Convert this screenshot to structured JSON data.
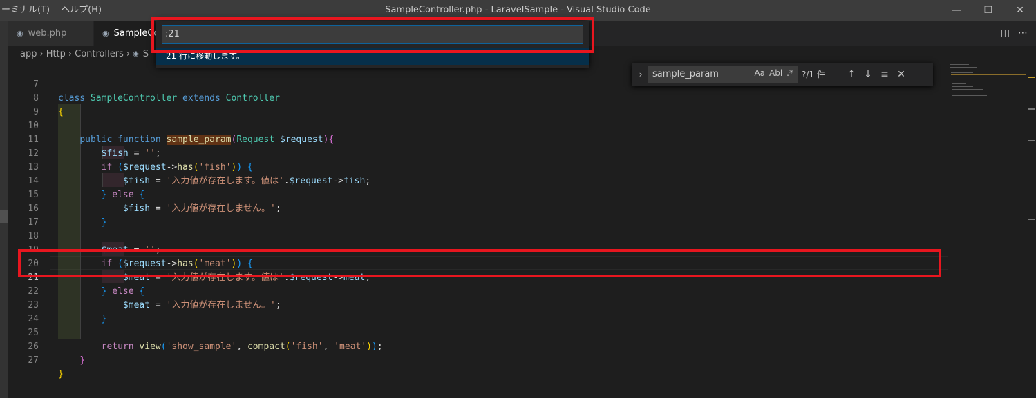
{
  "window": {
    "title": "SampleController.php - LaravelSample - Visual Studio Code",
    "menu": [
      "ーミナル(T)",
      "ヘルプ(H)"
    ]
  },
  "tabs": [
    {
      "label": "web.php",
      "active": false
    },
    {
      "label": "SampleController.php",
      "active": true
    }
  ],
  "breadcrumb": [
    "app",
    "Http",
    "Controllers",
    "S"
  ],
  "quick_open": {
    "value": ":21",
    "hint": "21 行に移動します。"
  },
  "find": {
    "query": "sample_param",
    "match_case": "Aa",
    "whole_word": "Abl",
    "regex": ".*",
    "result": "?/1 件"
  },
  "editor": {
    "current_line": 21,
    "lines": [
      {
        "n": "7",
        "text": "class SampleController extends Controller"
      },
      {
        "n": "8",
        "text": "{"
      },
      {
        "n": "9",
        "text": ""
      },
      {
        "n": "10",
        "text": "    public function sample_param(Request $request){"
      },
      {
        "n": "11",
        "text": "        $fish = '';"
      },
      {
        "n": "12",
        "text": "        if ($request->has('fish')) {"
      },
      {
        "n": "13",
        "text": "            $fish = '入力値が存在します。値は'.$request->fish;"
      },
      {
        "n": "14",
        "text": "        } else {"
      },
      {
        "n": "15",
        "text": "            $fish = '入力値が存在しません。';"
      },
      {
        "n": "16",
        "text": "        }"
      },
      {
        "n": "17",
        "text": ""
      },
      {
        "n": "18",
        "text": "        $meat = '';"
      },
      {
        "n": "19",
        "text": "        if ($request->has('meat')) {"
      },
      {
        "n": "20",
        "text": "            $meat = '入力値が存在します。値は'.$request->meat;"
      },
      {
        "n": "21",
        "text": "        } else {"
      },
      {
        "n": "22",
        "text": "            $meat = '入力値が存在しません。';"
      },
      {
        "n": "23",
        "text": "        }"
      },
      {
        "n": "24",
        "text": ""
      },
      {
        "n": "25",
        "text": "        return view('show_sample', compact('fish', 'meat'));"
      },
      {
        "n": "26",
        "text": "    }"
      },
      {
        "n": "27",
        "text": "}"
      }
    ]
  },
  "colors": {
    "annotation": "#e8161f",
    "accent": "#0e639c"
  }
}
